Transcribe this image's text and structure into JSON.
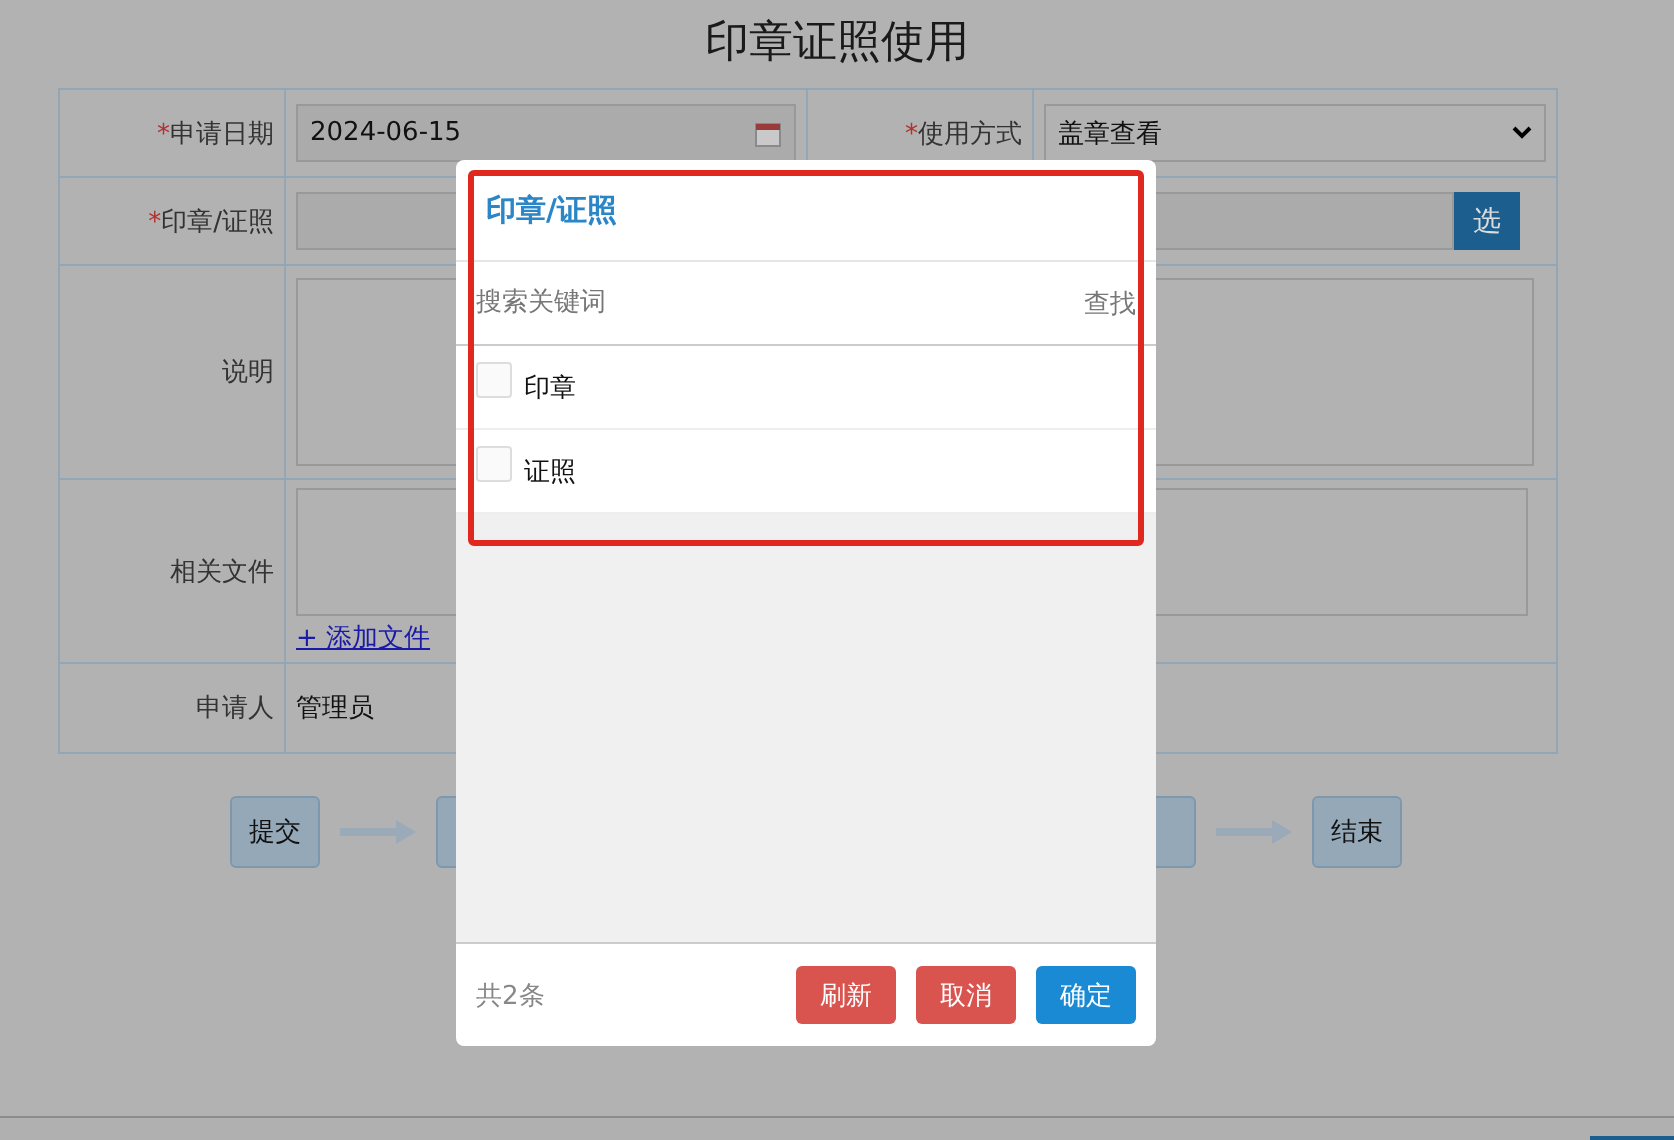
{
  "title": "印章证照使用",
  "form": {
    "apply_date": {
      "mark": "*",
      "label": "申请日期",
      "value": "2024-06-15"
    },
    "usage_method": {
      "mark": "*",
      "label": "使用方式",
      "value": "盖章查看"
    },
    "seal_cert": {
      "mark": "*",
      "label": "印章/证照",
      "button": "选"
    },
    "description": {
      "label": "说明"
    },
    "files": {
      "label": "相关文件",
      "add_link": "+ 添加文件"
    },
    "applicant": {
      "label": "申请人",
      "value": "管理员"
    }
  },
  "flow": {
    "first": "提交",
    "last": "结束"
  },
  "modal": {
    "title": "印章/证照",
    "highlighted": true,
    "search": {
      "placeholder": "搜索关键词",
      "button": "查找"
    },
    "options": [
      {
        "label": "印章",
        "checked": false
      },
      {
        "label": "证照",
        "checked": false
      }
    ],
    "count": "共2条",
    "buttons": [
      {
        "label": "刷新",
        "kind": "danger"
      },
      {
        "label": "取消",
        "kind": "danger"
      },
      {
        "label": "确定",
        "kind": "primary"
      }
    ]
  }
}
